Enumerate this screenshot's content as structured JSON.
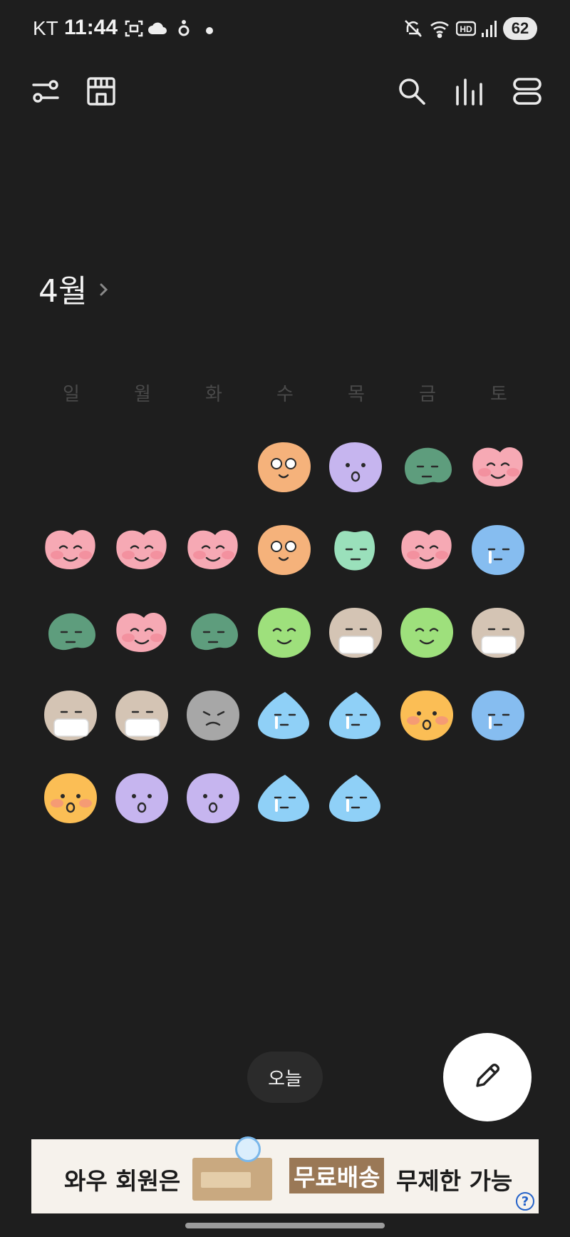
{
  "status_bar": {
    "carrier": "KT",
    "time": "11:44",
    "battery": "62"
  },
  "header": {
    "month": "4월"
  },
  "weekdays": [
    "일",
    "월",
    "화",
    "수",
    "목",
    "금",
    "토"
  ],
  "calendar": {
    "leading_blanks": 3,
    "days": [
      "orange-dizzy",
      "purple-shocked",
      "green-annoyed",
      "pink-happy",
      "pink-happy",
      "pink-happy",
      "pink-happy",
      "orange-dizzy",
      "mint-calm",
      "pink-happy",
      "blue-sad",
      "green-annoyed",
      "pink-happy",
      "green-annoyed",
      "lime-content",
      "beige-mask",
      "lime-content",
      "beige-mask",
      "beige-mask",
      "beige-mask",
      "gray-upset",
      "blue-crying",
      "blue-crying",
      "yellow-surprised",
      "blue-sad",
      "yellow-surprised",
      "purple-shocked",
      "purple-shocked",
      "blue-crying",
      "blue-crying"
    ],
    "mood_colors": {
      "orange-dizzy": "#f5b27b",
      "purple-shocked": "#c6b5ef",
      "green-annoyed": "#5e9d7d",
      "pink-happy": "#f6a9b4",
      "mint-calm": "#9ae0bb",
      "blue-sad": "#86bdf0",
      "lime-content": "#9ee07c",
      "beige-mask": "#d4c4b4",
      "gray-upset": "#a7a7a7",
      "blue-crying": "#8fd0f7",
      "yellow-surprised": "#fbbe55"
    }
  },
  "actions": {
    "today_label": "오늘",
    "fab_icon": "pencil-icon"
  },
  "ad": {
    "text1": "와우 회원은",
    "highlight": "무료배송",
    "text2": "무제한 가능",
    "help": "?"
  }
}
